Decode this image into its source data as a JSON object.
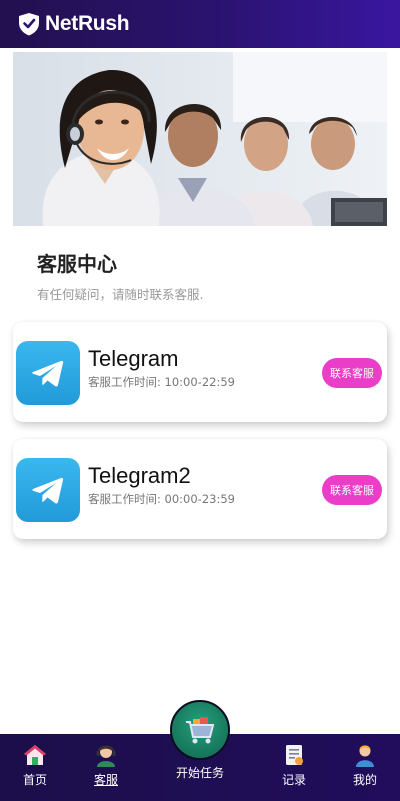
{
  "header": {
    "brand": "NetRush",
    "logo_icon": "shield-check-icon"
  },
  "banner": {
    "image": "customer-service-agents-photo"
  },
  "service": {
    "title": "客服中心",
    "subtitle": "有任何疑问，请随时联系客服."
  },
  "contacts": [
    {
      "name": "Telegram",
      "hours": "客服工作时间: 10:00-22:59",
      "button": "联系客服",
      "icon": "telegram-icon"
    },
    {
      "name": "Telegram2",
      "hours": "客服工作时间: 00:00-23:59",
      "button": "联系客服",
      "icon": "telegram-icon"
    }
  ],
  "nav": {
    "items": [
      {
        "label": "首页",
        "icon": "home-icon"
      },
      {
        "label": "客服",
        "icon": "support-agent-icon"
      },
      {
        "label": "开始任务",
        "icon": "shopping-cart-icon"
      },
      {
        "label": "记录",
        "icon": "records-icon"
      },
      {
        "label": "我的",
        "icon": "user-icon"
      }
    ],
    "active": "客服"
  },
  "colors": {
    "header_bg": "#2a1370",
    "nav_bg": "#1c0e4a",
    "button": "#ea3ec9",
    "telegram": "#2aa3e3",
    "start_button": "#1a8a68"
  }
}
